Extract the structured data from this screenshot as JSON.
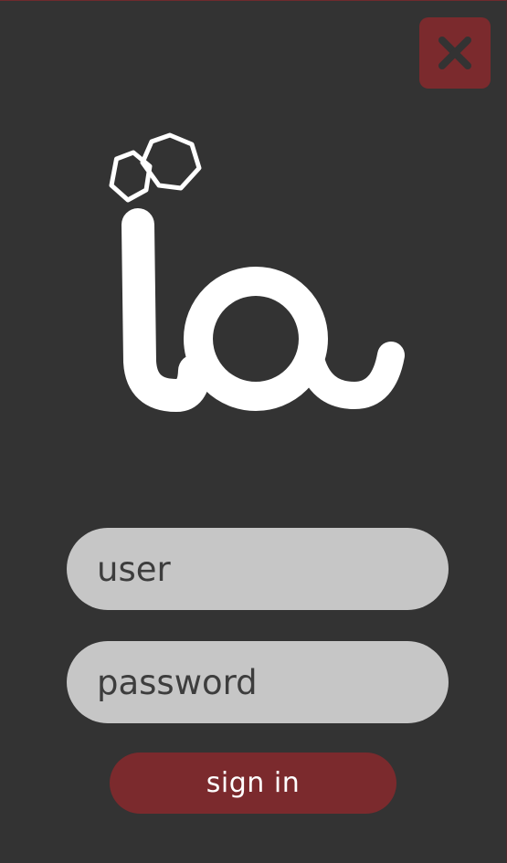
{
  "close": {
    "icon": "close-icon"
  },
  "logo": {
    "icon": "ia-logo-icon",
    "color": "#ffffff"
  },
  "form": {
    "user_placeholder": "user",
    "password_placeholder": "password",
    "signin_label": "sign in"
  },
  "colors": {
    "background": "#333333",
    "accent": "#7b2a2d",
    "field": "#c6c6c6"
  }
}
